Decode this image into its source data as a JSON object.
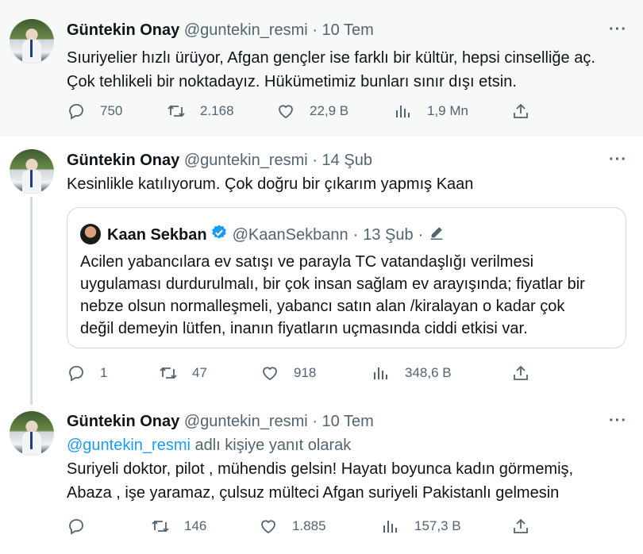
{
  "tweets": [
    {
      "name": "Güntekin Onay",
      "handle": "@guntekin_resmi",
      "sep": "·",
      "date": "10 Tem",
      "more": "···",
      "lines": [
        "Sıuriyelier hızlı ürüyor, Afgan gençler ise farklı bir kültür, hepsi cinselliğe aç.",
        "Çok tehlikeli bir noktadayız. Hükümetimiz bunları sınır dışı etsin."
      ],
      "actions": {
        "reply": "750",
        "retweet": "2.168",
        "like": "22,9 B",
        "views": "1,9 Mn"
      }
    },
    {
      "name": "Güntekin Onay",
      "handle": "@guntekin_resmi",
      "sep": "·",
      "date": "14 Şub",
      "more": "···",
      "lines": [
        "Kesinlikle katılıyorum. Çok doğru bir çıkarım yapmış Kaan"
      ],
      "quote": {
        "name": "Kaan Sekban",
        "handle": "@KaanSekbann",
        "sep": "·",
        "date": "13 Şub",
        "sep2": "·",
        "lines": [
          "Acilen yabancılara ev satışı ve parayla TC vatandaşlığı verilmesi",
          "uygulaması durdurulmalı, bir çok insan sağlam ev arayışında; fiyatlar bir",
          "nebze olsun normalleşmeli, yabancı satın alan /kiralayan o kadar çok",
          "değil demeyin lütfen, inanın fiyatların uçmasında ciddi etkisi var."
        ]
      },
      "actions": {
        "reply": "1",
        "retweet": "47",
        "like": "918",
        "views": "348,6 B"
      }
    },
    {
      "name": "Güntekin Onay",
      "handle": "@guntekin_resmi",
      "sep": "·",
      "date": "10 Tem",
      "more": "···",
      "reply_to": {
        "mention": "@guntekin_resmi",
        "suffix": " adlı kişiye yanıt olarak"
      },
      "lines": [
        "Suriyeli doktor, pilot , mühendis gelsin! Hayatı boyunca kadın görmemiş,",
        "Abaza , işe yaramaz, çulsuz mülteci Afgan suriyeli Pakistanlı  gelmesin"
      ],
      "actions": {
        "reply": "",
        "retweet": "146",
        "like": "1.885",
        "views": "157,3 B"
      }
    }
  ],
  "colors": {
    "accent": "#1d9bf0",
    "text": "#0f1419",
    "muted": "#536471",
    "border": "#cfd9de",
    "highlight_bg": "#f7f9f9"
  },
  "icons": {
    "reply": "reply-icon",
    "retweet": "retweet-icon",
    "like": "like-icon",
    "views": "views-icon",
    "share": "share-icon",
    "edit": "edited-icon",
    "verified": "verified-badge-icon"
  }
}
